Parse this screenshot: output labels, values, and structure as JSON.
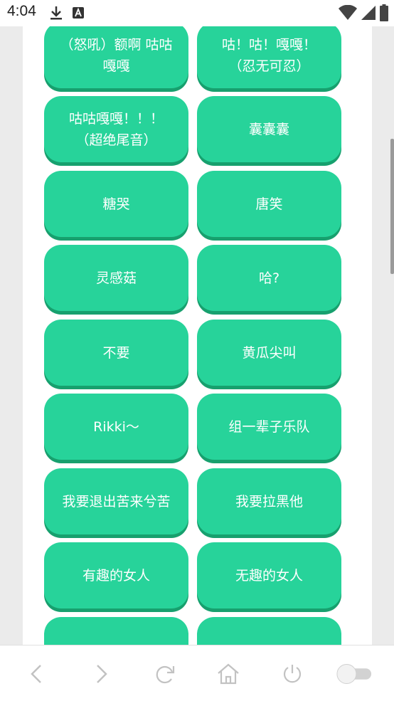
{
  "status_bar": {
    "time": "4:04",
    "left_icons": [
      "download-icon",
      "app-notification-icon"
    ],
    "right_icons": [
      "wifi-icon",
      "signal-icon",
      "battery-icon"
    ]
  },
  "buttons": [
    {
      "label": "（怒吼）额啊 咕咕\n嘎嘎"
    },
    {
      "label": "咕！咕！嘎嘎！\n（忍无可忍）"
    },
    {
      "label": "咕咕嘎嘎！！！\n（超绝尾音）"
    },
    {
      "label": "囊囊囊"
    },
    {
      "label": "糖哭"
    },
    {
      "label": "唐笑"
    },
    {
      "label": "灵感菇"
    },
    {
      "label": "哈?"
    },
    {
      "label": "不要"
    },
    {
      "label": "黄瓜尖叫"
    },
    {
      "label": "Rikki～"
    },
    {
      "label": "组一辈子乐队"
    },
    {
      "label": "我要退出苦来兮苦"
    },
    {
      "label": "我要拉黑他"
    },
    {
      "label": "有趣的女人"
    },
    {
      "label": "无趣的女人"
    },
    {
      "label": ""
    },
    {
      "label": ""
    }
  ],
  "bottom_nav": [
    "back-icon",
    "forward-icon",
    "refresh-icon",
    "home-icon",
    "power-icon",
    "toggle-switch"
  ],
  "colors": {
    "button_green": "#27d39a",
    "button_shadow": "#17a06e"
  }
}
